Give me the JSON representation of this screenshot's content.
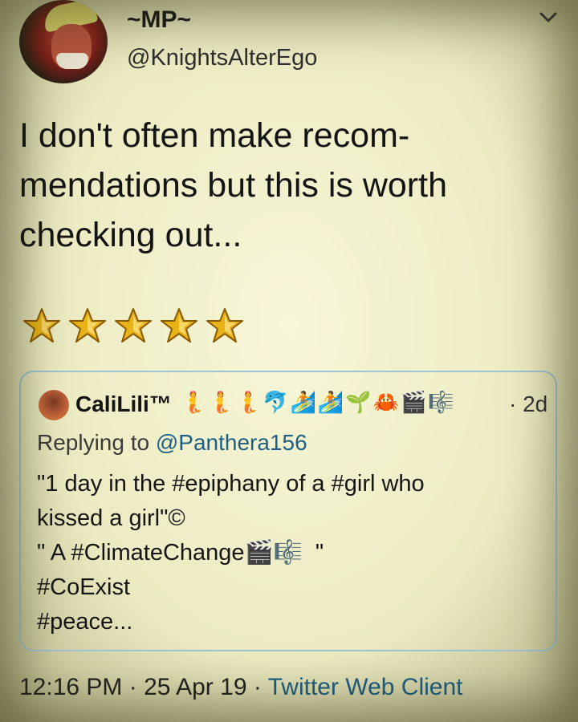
{
  "author": {
    "display_name": "~MP~",
    "handle": "@KnightsAlterEgo"
  },
  "tweet": {
    "text_lines": [
      "I don't often make recom-",
      "mendations but this is worth",
      "checking out..."
    ],
    "rating_stars": 5
  },
  "quoted": {
    "name": "CaliLili™",
    "name_emoji": "🧜🧜🧜🐬🏄🏄🌱🦀🎬🎼",
    "time": "· 2d",
    "replying_label": "Replying to ",
    "replying_mention": "@Panthera156",
    "lines": [
      "\"1 day in the #epiphany of a #girl who",
      "kissed a girl\"©",
      "\" A #ClimateChange🎬🎼  \"",
      "#CoExist",
      "#peace..."
    ]
  },
  "footer": {
    "timestamp": "12:16 PM · 25 Apr 19 · ",
    "client": "Twitter Web Client"
  },
  "colors": {
    "link": "#1d5f86",
    "quote_border": "#9fc4d6",
    "star": "#e8b317"
  },
  "icons": {
    "more": "chevron-down-icon",
    "rating": "star-icon"
  }
}
